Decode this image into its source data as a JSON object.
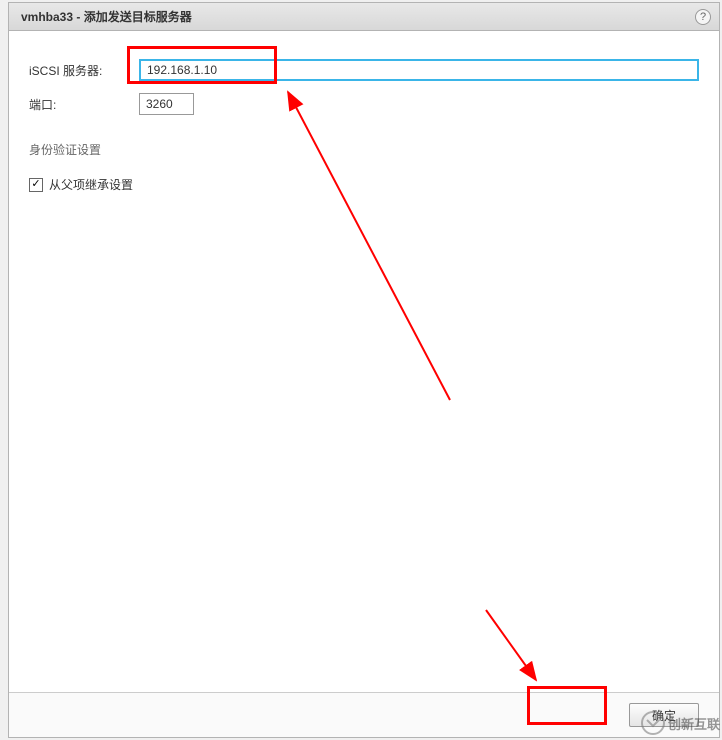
{
  "titlebar": {
    "title": "vmhba33 - 添加发送目标服务器"
  },
  "form": {
    "server_label": "iSCSI 服务器:",
    "server_value": "192.168.1.10",
    "port_label": "端口:",
    "port_value": "3260"
  },
  "auth": {
    "section_title": "身份验证设置",
    "inherit_label": "从父项继承设置",
    "inherit_checked": true
  },
  "footer": {
    "ok_label": "确定"
  },
  "watermark": {
    "text": "创新互联"
  }
}
